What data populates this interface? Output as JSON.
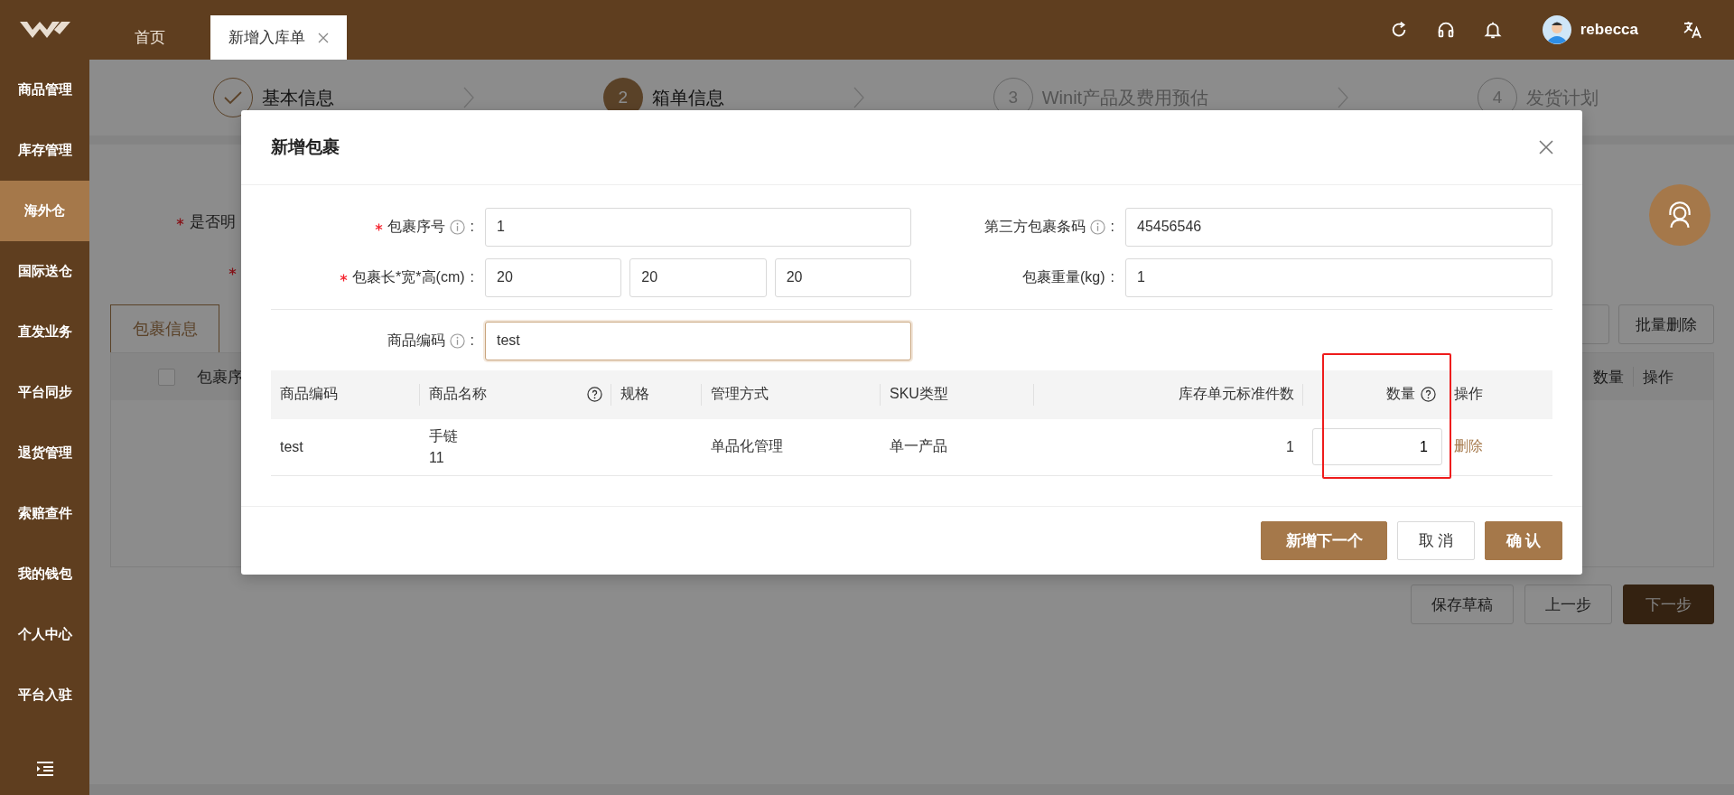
{
  "topbar": {
    "tabs": [
      {
        "label": "首页",
        "selected": false,
        "closable": false
      },
      {
        "label": "新增入库单",
        "selected": true,
        "closable": true
      }
    ],
    "user": {
      "name": "rebecca"
    }
  },
  "sidebar": {
    "items": [
      {
        "label": "商品管理",
        "selected": false
      },
      {
        "label": "库存管理",
        "selected": false
      },
      {
        "label": "海外仓",
        "selected": true
      },
      {
        "label": "国际送仓",
        "selected": false
      },
      {
        "label": "直发业务",
        "selected": false
      },
      {
        "label": "平台同步",
        "selected": false
      },
      {
        "label": "退货管理",
        "selected": false
      },
      {
        "label": "索赔查件",
        "selected": false
      },
      {
        "label": "我的钱包",
        "selected": false
      },
      {
        "label": "个人中心",
        "selected": false
      },
      {
        "label": "平台入驻",
        "selected": false
      }
    ]
  },
  "steps": [
    {
      "done": true,
      "selected": false,
      "label": "基本信息"
    },
    {
      "done": false,
      "selected": true,
      "number": "2",
      "label": "箱单信息"
    },
    {
      "done": false,
      "selected": false,
      "number": "3",
      "label": "Winit产品及费用预估"
    },
    {
      "done": false,
      "selected": false,
      "number": "4",
      "label": "发货计划"
    }
  ],
  "page_form": {
    "rows": [
      {
        "required": true,
        "label": "是否明"
      },
      {
        "required": true
      }
    ]
  },
  "package_tabs": [
    {
      "label": "包裹信息",
      "selected": true
    }
  ],
  "toolbar_buttons": [
    {
      "label": "批量删除"
    }
  ],
  "package_table": {
    "checked": false,
    "columns_left": [
      "包裹序"
    ],
    "columns_right": [
      "数量",
      "操作"
    ]
  },
  "page_buttons": [
    {
      "label": "保存草稿",
      "kind": "default"
    },
    {
      "label": "上一步",
      "kind": "default"
    },
    {
      "label": "下一步",
      "kind": "primary"
    }
  ],
  "dialog": {
    "title": "新增包裹",
    "fields": [
      {
        "label": "包裹序号",
        "required": true,
        "info": true,
        "suffix": ":",
        "values": [
          "1"
        ],
        "focused": false
      },
      {
        "label": "第三方包裹条码",
        "required": false,
        "info": true,
        "suffix": ":",
        "values": [
          "45456546"
        ],
        "focused": false
      },
      {
        "label": "包裹长*宽*高(cm)",
        "required": true,
        "info": false,
        "suffix": ":",
        "values": [
          "20",
          "20",
          "20"
        ],
        "focused": false
      },
      {
        "label": "包裹重量(kg)",
        "required": false,
        "info": false,
        "suffix": ":",
        "values": [
          "1"
        ],
        "focused": false
      },
      {
        "label": "商品编码",
        "required": false,
        "info": true,
        "suffix": ":",
        "values": [
          "test"
        ],
        "focused": true
      }
    ],
    "table": {
      "columns": [
        {
          "label": "商品编码",
          "numeric": false,
          "help": false,
          "highlighted": false
        },
        {
          "label": "商品名称",
          "numeric": false,
          "help": true,
          "highlighted": false
        },
        {
          "label": "规格",
          "numeric": false,
          "help": false,
          "highlighted": false
        },
        {
          "label": "管理方式",
          "numeric": false,
          "help": false,
          "highlighted": false
        },
        {
          "label": "SKU类型",
          "numeric": false,
          "help": false,
          "highlighted": false
        },
        {
          "label": "库存单元标准件数",
          "numeric": true,
          "help": false,
          "highlighted": false
        },
        {
          "label": "数量",
          "numeric": true,
          "help": true,
          "highlighted": true
        },
        {
          "label": "操作",
          "numeric": false,
          "help": false,
          "highlighted": false
        }
      ],
      "rows": [
        {
          "cells": [
            {
              "kind": "text",
              "text": "test"
            },
            {
              "kind": "lines",
              "lines": [
                "手链",
                "11"
              ]
            },
            {
              "kind": "blank"
            },
            {
              "kind": "text",
              "text": "单品化管理"
            },
            {
              "kind": "text",
              "text": "单一产品"
            },
            {
              "kind": "text",
              "text": "1"
            },
            {
              "kind": "input",
              "value": "1"
            },
            {
              "kind": "link",
              "text": "删除"
            }
          ]
        }
      ]
    },
    "buttons": [
      {
        "label": "新增下一个",
        "kind": "primary"
      },
      {
        "label": "取 消",
        "kind": "default"
      },
      {
        "label": "确 认",
        "kind": "primary"
      }
    ]
  }
}
